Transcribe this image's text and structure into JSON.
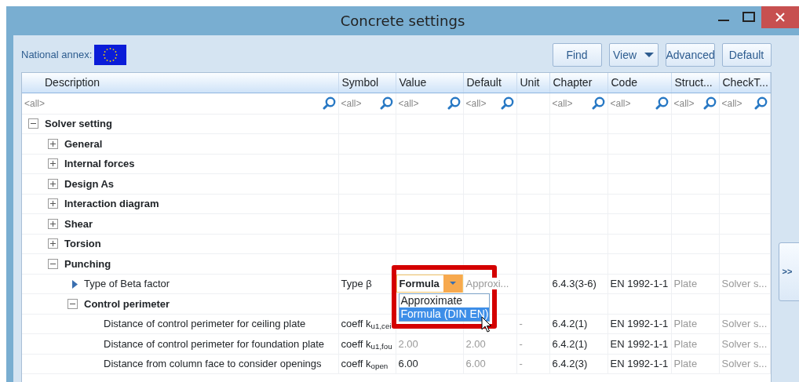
{
  "window": {
    "title": "Concrete settings"
  },
  "toolbar": {
    "national_annex_label": "National annex:",
    "buttons": [
      {
        "label": "Find",
        "kind": "plain"
      },
      {
        "label": "View",
        "kind": "menu"
      },
      {
        "label": "Advanced",
        "kind": "plain"
      },
      {
        "label": "Default",
        "kind": "plain"
      }
    ]
  },
  "columns": [
    {
      "label": "Description",
      "filter_placeholder": "<all>"
    },
    {
      "label": "Symbol",
      "filter_placeholder": "<all>"
    },
    {
      "label": "Value",
      "filter_placeholder": "<all>"
    },
    {
      "label": "Default",
      "filter_placeholder": "<all>"
    },
    {
      "label": "Unit"
    },
    {
      "label": "Chapter",
      "filter_placeholder": "<all>"
    },
    {
      "label": "Code",
      "filter_placeholder": "<all>"
    },
    {
      "label": "Struct...",
      "filter_placeholder": "<all>"
    },
    {
      "label": "CheckT...",
      "filter_placeholder": "<all>"
    }
  ],
  "rows": [
    {
      "kind": "group",
      "label": "Solver setting",
      "expanded": true,
      "children": [
        {
          "kind": "group",
          "label": "General",
          "expanded": false
        },
        {
          "kind": "group",
          "label": "Internal forces",
          "expanded": false
        },
        {
          "kind": "group",
          "label": "Design As",
          "expanded": false
        },
        {
          "kind": "group",
          "label": "Interaction diagram",
          "expanded": false
        },
        {
          "kind": "group",
          "label": "Shear",
          "expanded": false
        },
        {
          "kind": "group",
          "label": "Torsion",
          "expanded": false
        },
        {
          "kind": "group",
          "label": "Punching",
          "expanded": true,
          "children": [
            {
              "kind": "setting",
              "label": "Type of Beta factor",
              "current": true,
              "symbol": "Type β",
              "editor": {
                "value": "Formula",
                "highlighted": true,
                "options": [
                  {
                    "label": "Approximate",
                    "selected": false
                  },
                  {
                    "label": "Formula (DIN EN)",
                    "selected": true
                  }
                ]
              },
              "default": "Approxi...",
              "chapter": "6.4.3(3-6)",
              "code": "EN 1992-1-1",
              "structure": "Plate",
              "check_type": "Solver s..."
            },
            {
              "kind": "group",
              "label": "Control perimeter",
              "expanded": true,
              "children": [
                {
                  "kind": "setting",
                  "label": "Distance of control perimeter for ceiling plate",
                  "current": false,
                  "symbol": "coeff k$_{u1,cei}$",
                  "unit": "-",
                  "chapter": "6.4.2(1)",
                  "code": "EN 1992-1-1",
                  "structure": "Plate",
                  "check_type": "Solver s..."
                },
                {
                  "kind": "setting",
                  "label": "Distance of control perimeter for foundation plate",
                  "current": false,
                  "symbol": "coeff k$_{u1,fou}$",
                  "value": "2.00",
                  "value_dimmed": true,
                  "default": "2.00",
                  "unit": "-",
                  "chapter": "6.4.2(1)",
                  "code": "EN 1992-1-1",
                  "structure": "Plate",
                  "check_type": "Solver s..."
                },
                {
                  "kind": "setting",
                  "label": "Distance from column face to consider openings",
                  "current": false,
                  "symbol": "coeff k$_{open}$",
                  "value": "6.00",
                  "value_dimmed": false,
                  "default": "6.00",
                  "unit": "-",
                  "chapter": "6.4.2(3)",
                  "code": "EN 1992-1-1",
                  "structure": "Plate",
                  "check_type": "Solver s..."
                }
              ]
            }
          ]
        }
      ]
    }
  ],
  "side_button": {
    "label": ">>"
  }
}
